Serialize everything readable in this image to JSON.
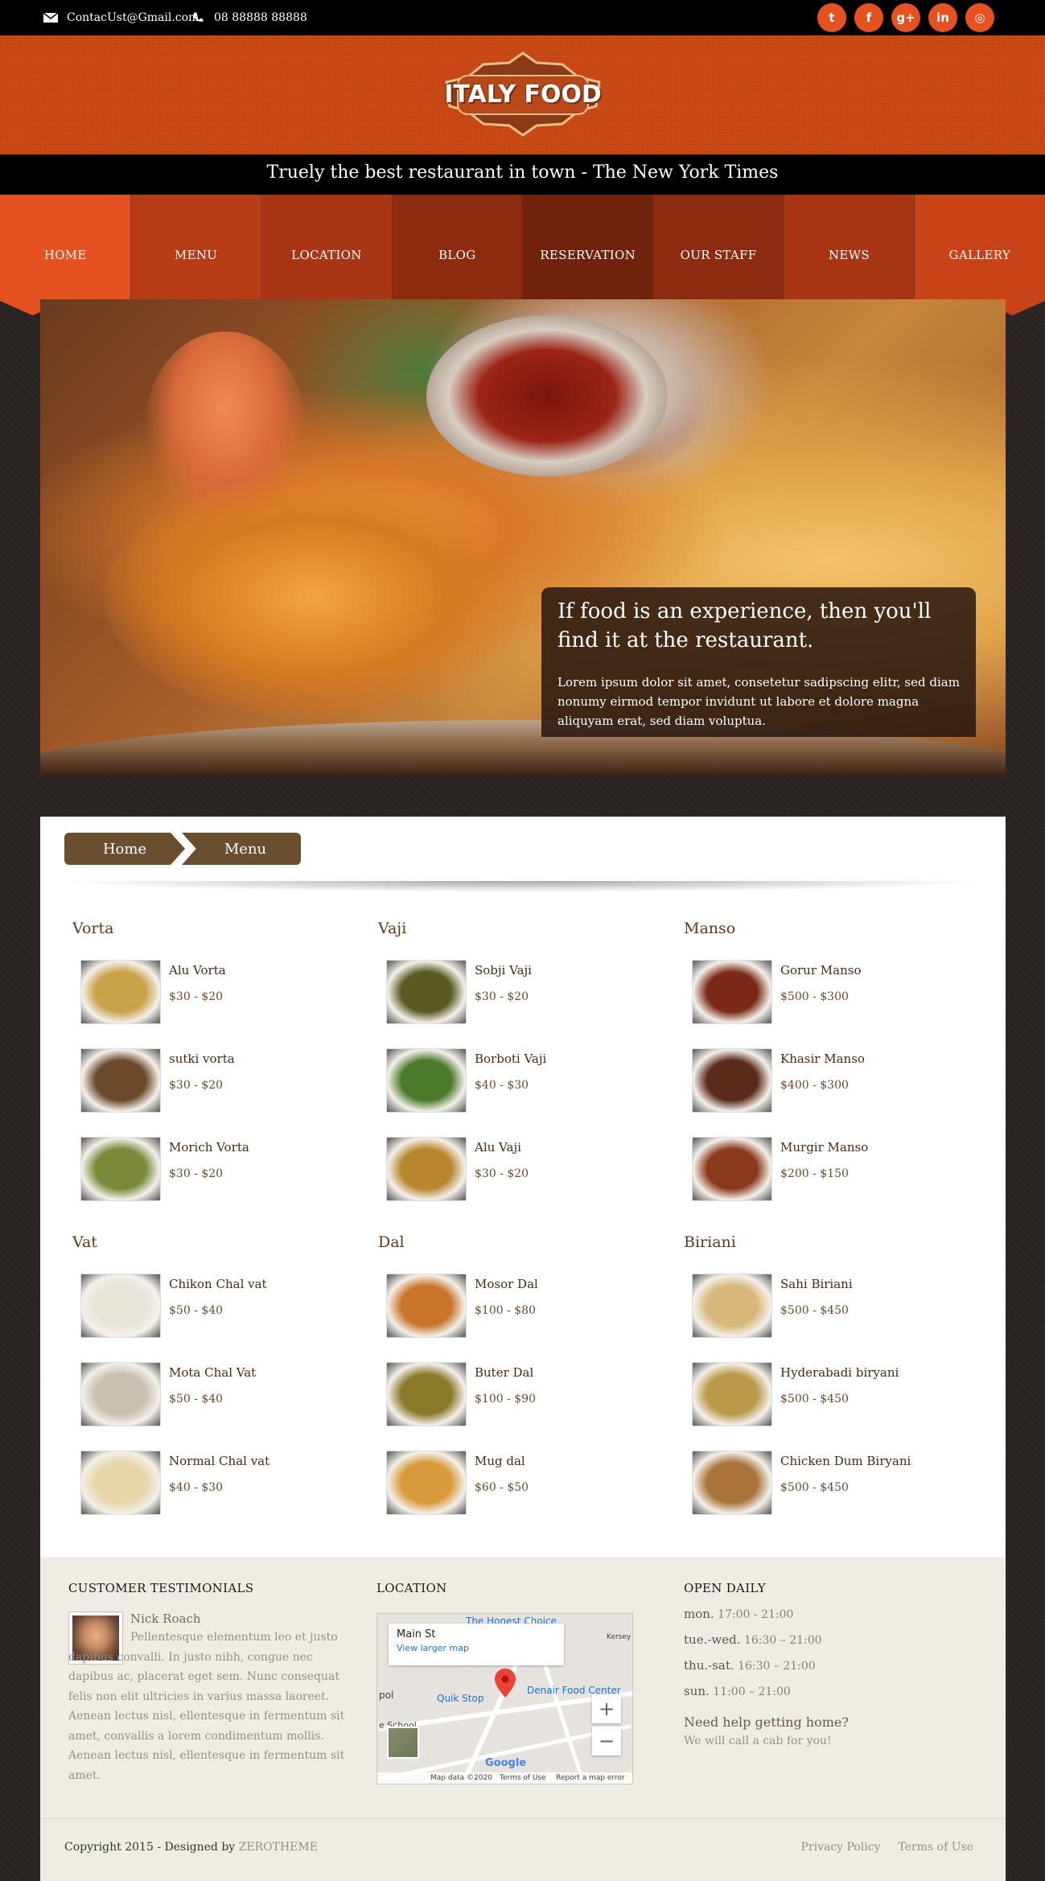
{
  "topbar": {
    "email": "ContacUst@Gmail.com",
    "phone": "08 88888 88888",
    "socials": [
      {
        "name": "twitter-icon",
        "glyph": "t"
      },
      {
        "name": "facebook-icon",
        "glyph": "f"
      },
      {
        "name": "google-plus-icon",
        "glyph": "g+"
      },
      {
        "name": "linkedin-icon",
        "glyph": "in"
      },
      {
        "name": "instagram-icon",
        "glyph": "◎"
      }
    ]
  },
  "logo": {
    "text": "ITALY FOOD"
  },
  "tagline": "Truely the best restaurant in town - The New York Times",
  "nav": {
    "items": [
      {
        "label": "HOME",
        "color": "#e5521f"
      },
      {
        "label": "MENU",
        "color": "#b83d16"
      },
      {
        "label": "LOCATION",
        "color": "#a83513"
      },
      {
        "label": "BLOG",
        "color": "#8c2b10"
      },
      {
        "label": "RESERVATION",
        "color": "#6f230c"
      },
      {
        "label": "OUR STAFF",
        "color": "#8c2b10"
      },
      {
        "label": "NEWS",
        "color": "#a83513"
      },
      {
        "label": "GALLERY",
        "color": "#c84317"
      }
    ]
  },
  "hero": {
    "heading": "If food is an experience, then you'll find it at the restaurant.",
    "body": "Lorem ipsum dolor sit amet, consetetur sadipscing elitr, sed diam nonumy eirmod tempor invidunt ut labore et dolore magna aliquyam erat, sed diam voluptua."
  },
  "breadcrumb": {
    "home": "Home",
    "current": "Menu"
  },
  "menu": {
    "categories": [
      {
        "title": "Vorta",
        "items": [
          {
            "name": "Alu Vorta",
            "price": "$30 - $20",
            "color": "#c9a24a"
          },
          {
            "name": "sutki vorta",
            "price": "$30 - $20",
            "color": "#6a4a2a"
          },
          {
            "name": "Morich Vorta",
            "price": "$30 - $20",
            "color": "#7a8a3a"
          }
        ]
      },
      {
        "title": "Vaji",
        "items": [
          {
            "name": "Sobji Vaji",
            "price": "$30 - $20",
            "color": "#5a5a22"
          },
          {
            "name": "Borboti Vaji",
            "price": "$40 - $30",
            "color": "#4a7a2a"
          },
          {
            "name": "Alu Vaji",
            "price": "$30 - $20",
            "color": "#b8862e"
          }
        ]
      },
      {
        "title": "Manso",
        "items": [
          {
            "name": "Gorur Manso",
            "price": "$500 - $300",
            "color": "#7a2a16"
          },
          {
            "name": "Khasir Manso",
            "price": "$400 - $300",
            "color": "#5a2a1a"
          },
          {
            "name": "Murgir Manso",
            "price": "$200 - $150",
            "color": "#8a3a1a"
          }
        ]
      },
      {
        "title": "Vat",
        "items": [
          {
            "name": "Chikon Chal vat",
            "price": "$50 - $40",
            "color": "#e8e4da"
          },
          {
            "name": "Mota Chal Vat",
            "price": "$50 - $40",
            "color": "#c8c0b0"
          },
          {
            "name": "Normal Chal vat",
            "price": "$40 - $30",
            "color": "#e6d6a8"
          }
        ]
      },
      {
        "title": "Dal",
        "items": [
          {
            "name": "Mosor Dal",
            "price": "$100 - $80",
            "color": "#c8742a"
          },
          {
            "name": "Buter Dal",
            "price": "$100 - $90",
            "color": "#8a7a2a"
          },
          {
            "name": "Mug dal",
            "price": "$60 - $50",
            "color": "#d89a3a"
          }
        ]
      },
      {
        "title": "Biriani",
        "items": [
          {
            "name": "Sahi Biriani",
            "price": "$500 - $450",
            "color": "#d8b87a"
          },
          {
            "name": "Hyderabadi biryani",
            "price": "$500 - $450",
            "color": "#b89a4a"
          },
          {
            "name": "Chicken Dum Biryani",
            "price": "$500 - $450",
            "color": "#a8743a"
          }
        ]
      }
    ]
  },
  "footer": {
    "testimonials": {
      "heading": "CUSTOMER TESTIMONIALS",
      "name": "Nick Roach",
      "text": "Pellentesque elementum leo et justo dapibus convalli. In justo nibh, congue nec dapibus ac, placerat eget sem. Nunc consequat felis non elit ultricies in varius massa laoreet. Aenean lectus nisl, ellentesque in fermentum sit amet, convallis a lorem condimentum mollis. Aenean lectus nisl, ellentesque in fermentum sit amet."
    },
    "location": {
      "heading": "LOCATION",
      "map_place": "Main St",
      "map_link": "View larger map",
      "labels": [
        "The Honest Choice",
        "Quik Stop",
        "Denair Food Center",
        "Kersey",
        "pol",
        "e School"
      ],
      "footer_items": [
        "Map data ©2020",
        "Terms of Use",
        "Report a map error"
      ],
      "zoom_in": "+",
      "zoom_out": "−"
    },
    "hours": {
      "heading": "OPEN DAILY",
      "rows": [
        {
          "day": "mon.",
          "time": "17:00 - 21:00"
        },
        {
          "day": "tue.-wed.",
          "time": "16:30 – 21:00"
        },
        {
          "day": "thu.-sat.",
          "time": "16:30 – 21:00"
        },
        {
          "day": "sun.",
          "time": "11:00 – 21:00"
        }
      ],
      "help": "Need help getting home?",
      "help_sub": "We will call a cab for you!"
    },
    "copyright": "Copyright 2015 - Designed by",
    "brand": "ZEROTHEME",
    "links": [
      "Privacy Policy",
      "Terms of Use"
    ]
  }
}
